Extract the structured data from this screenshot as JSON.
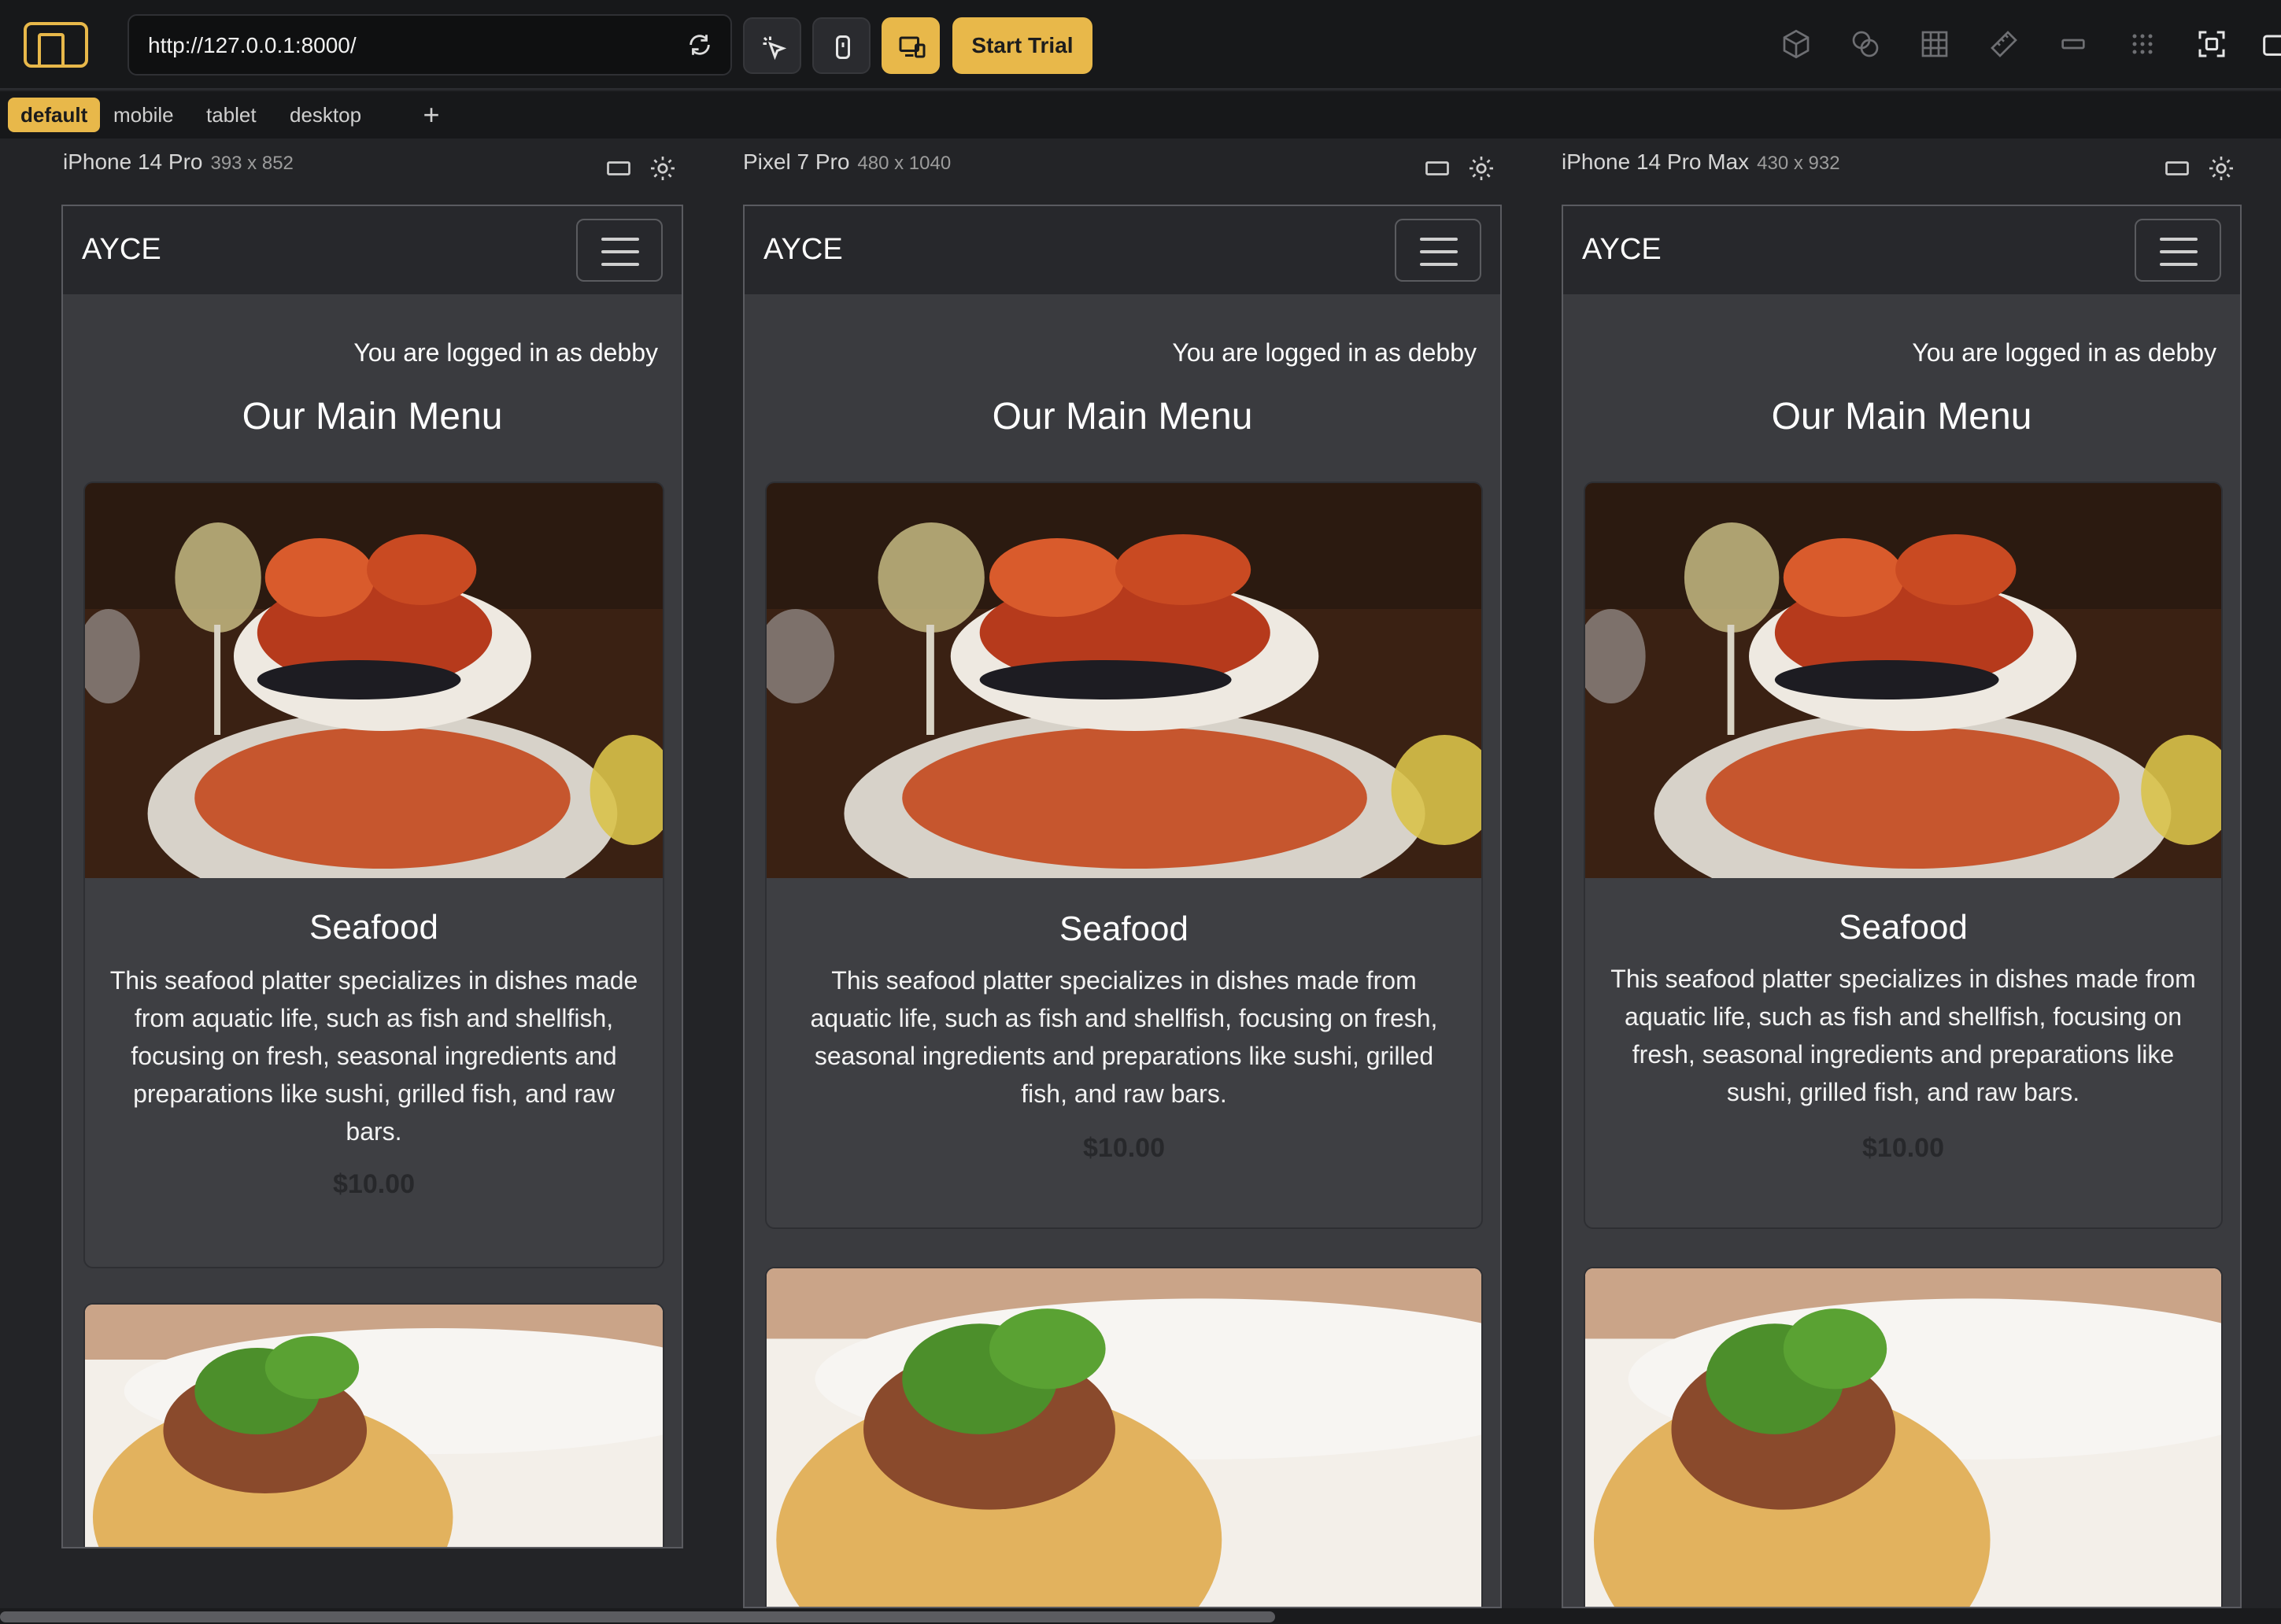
{
  "toolbar": {
    "url": "http://127.0.0.1:8000/",
    "start_trial": "Start Trial"
  },
  "tabs": [
    "default",
    "mobile",
    "tablet",
    "desktop"
  ],
  "devices": [
    {
      "name": "iPhone 14 Pro",
      "dims": "393 x 852"
    },
    {
      "name": "Pixel 7 Pro",
      "dims": "480 x 1040"
    },
    {
      "name": "iPhone 14 Pro Max",
      "dims": "430 x 932"
    }
  ],
  "site": {
    "brand": "AYCE",
    "logged_in": "You are logged in as debby",
    "menu_title": "Our Main Menu",
    "dish": {
      "title": "Seafood",
      "description": "This seafood platter specializes in dishes made from aquatic life, such as fish and shellfish, focusing on fresh, seasonal ingredients and preparations like sushi, grilled fish, and raw bars.",
      "price": "$10.00"
    }
  },
  "colors": {
    "accent": "#e8b84a",
    "site_background": "#3a3b3f",
    "navbar": "#27282c"
  },
  "icons": [
    "responsively-logo-icon",
    "reload-icon",
    "inspect-element-icon",
    "mobile-icon",
    "device-preview-icon",
    "cube-icon",
    "layers-icon",
    "grid-icon",
    "ruler-icon",
    "rotate-icon",
    "dots-grid-icon",
    "screenshot-icon",
    "window-icon",
    "plus-icon",
    "rotate-device-icon",
    "settings-gear-icon",
    "hamburger-icon"
  ]
}
